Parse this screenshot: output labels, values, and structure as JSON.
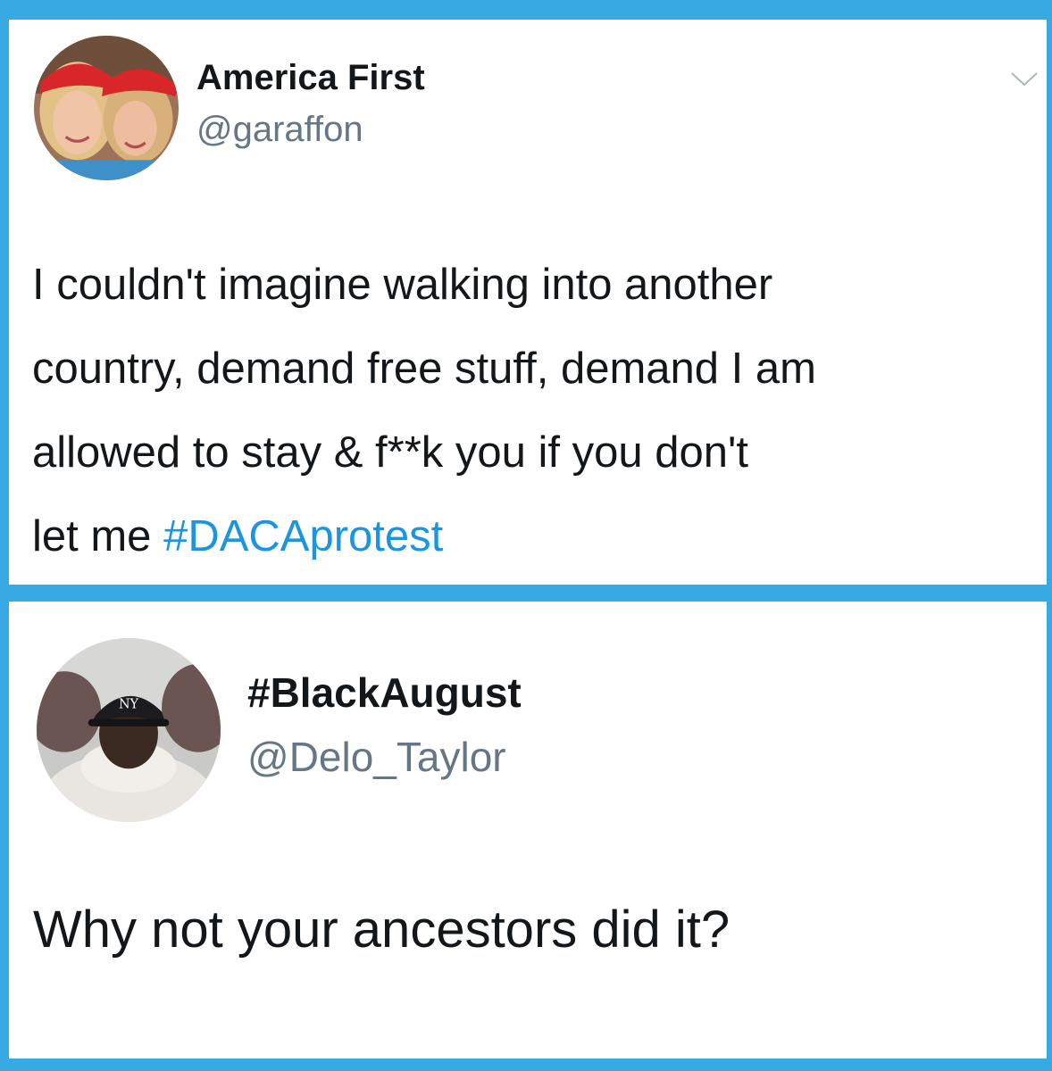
{
  "colors": {
    "frame": "#37a9e3",
    "card_background": "#ffffff",
    "text": "#14171a",
    "handle": "#657786",
    "hashtag": "#1b95e0"
  },
  "tweet_1": {
    "display_name": "America First",
    "handle": "@garaffon",
    "avatar": "profile-photo-two-women-red-caps",
    "menu_icon": "chevron-down-icon",
    "text_lines": [
      "I couldn't imagine walking into another",
      "country, demand free stuff, demand I am",
      "allowed to stay &  f**k you if you don't"
    ],
    "last_line_prefix": "let me ",
    "hashtag": "#DACAprotest"
  },
  "tweet_2": {
    "display_name": "#BlackAugust",
    "handle": "@Delo_Taylor",
    "avatar": "profile-photo-man-in-cap-and-scarf",
    "text": "Why not your ancestors did it?"
  }
}
